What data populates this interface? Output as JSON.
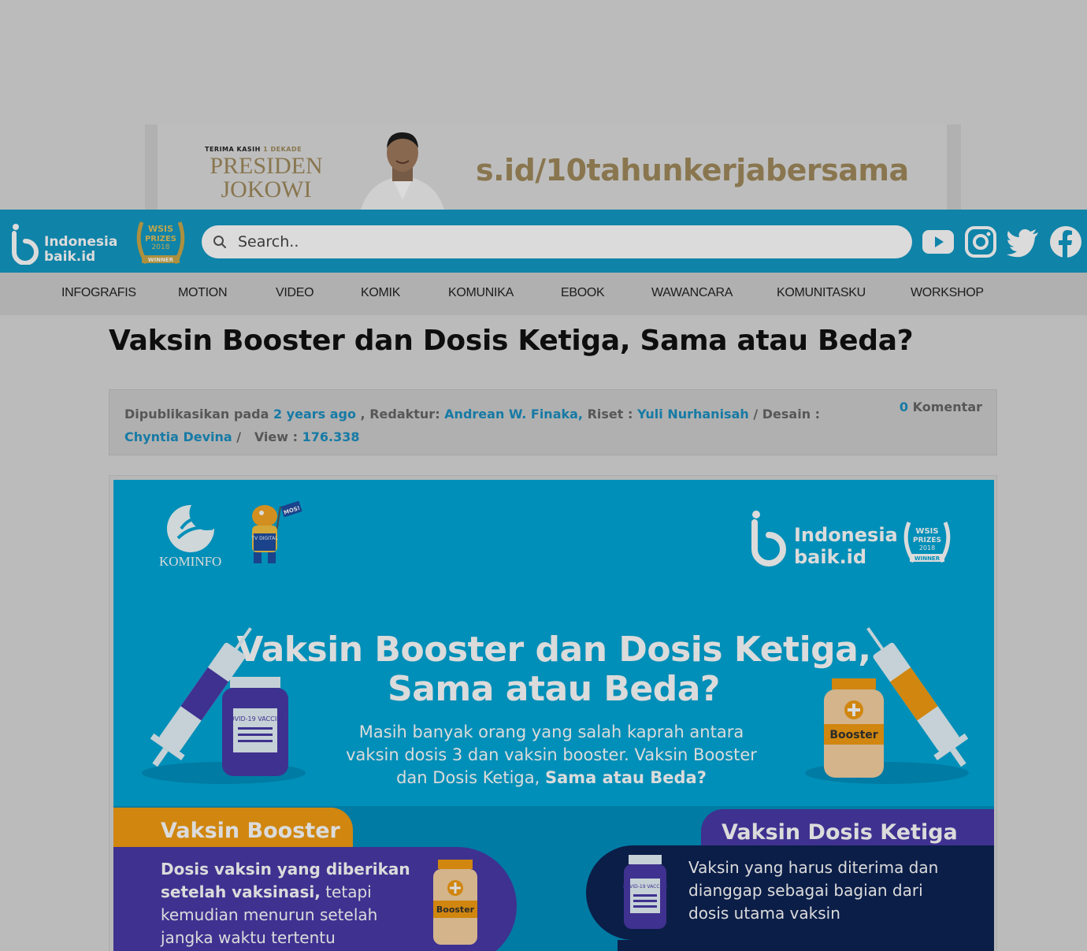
{
  "banner": {
    "small_text_a": "TERIMA KASIH",
    "small_text_b": "1 DEKADE",
    "president_line1": "PRESIDEN",
    "president_line2": "JOKOWI",
    "url": "s.id/10tahunkerjabersama"
  },
  "header": {
    "logo_line1": "Indonesia",
    "logo_line2": "baik.id",
    "wsis_badge": [
      "WSIS",
      "PRIZES",
      "2018",
      "WINNER"
    ],
    "search_placeholder": "Search..",
    "social": [
      "youtube-icon",
      "instagram-icon",
      "twitter-icon",
      "facebook-icon"
    ],
    "brand_color": "#1299c4"
  },
  "nav": {
    "items": [
      "INFOGRAFIS",
      "MOTION",
      "VIDEO",
      "KOMIK",
      "KOMUNIKA",
      "EBOOK",
      "WAWANCARA",
      "KOMUNITASKU",
      "WORKSHOP"
    ]
  },
  "article": {
    "title": "Vaksin Booster dan Dosis Ketiga, Sama atau Beda?",
    "meta": {
      "published_label": "Dipublikasikan pada",
      "published_value": "2 years ago",
      "editor_label": ", Redaktur:",
      "editor_value": "Andrean W. Finaka,",
      "research_label": "Riset :",
      "research_value": "Yuli Nurhanisah",
      "design_label": "/ Desain :",
      "design_value": "Chyntia Devina",
      "sep": "/",
      "view_label": "View :",
      "view_value": "176.338",
      "comment_count": "0",
      "comment_label": "Komentar"
    }
  },
  "infographic": {
    "kominfo": "KOMINFO",
    "mascot_flag": "MOS!",
    "mascot_tv": "TV DIGITAL",
    "logo_line1": "Indonesia",
    "logo_line2": "baik.id",
    "headline_line1": "Vaksin Booster dan Dosis Ketiga,",
    "headline_line2": "Sama atau Beda?",
    "intro_plain": "Masih banyak orang yang salah kaprah antara vaksin dosis 3 dan vaksin booster. Vaksin Booster dan Dosis Ketiga,",
    "intro_bold": "Sama atau Beda?",
    "vial_label_covid": "COVID-19 VACCINE",
    "vial_label_booster": "Booster",
    "booster_tag": "Vaksin Booster",
    "booster_text_bold": "Dosis vaksin yang diberikan setelah vaksinasi,",
    "booster_text_rest": "tetapi kemudian menurun setelah jangka waktu tertentu",
    "dosis_tag": "Vaksin Dosis Ketiga",
    "dosis_text": "Vaksin yang harus diterima dan dianggap sebagai bagian dari dosis utama vaksin"
  }
}
